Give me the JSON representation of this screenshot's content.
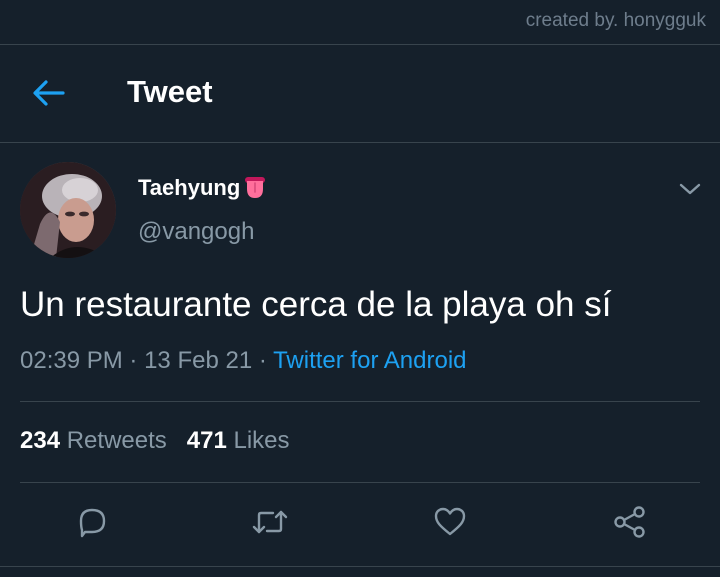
{
  "watermark": "created by. honygguk",
  "header": {
    "title": "Tweet",
    "back_icon": "arrow-left-icon"
  },
  "tweet": {
    "display_name": "Taehyung",
    "name_emoji_icon": "tongue-emoji-icon",
    "handle": "@vangogh",
    "text": "Un restaurante cerca de la playa oh sí",
    "time": "02:39 PM",
    "separator": "·",
    "date": "13 Feb 21",
    "source": "Twitter for Android"
  },
  "stats": {
    "retweets_count": "234",
    "retweets_label": "Retweets",
    "likes_count": "471",
    "likes_label": "Likes"
  },
  "actions": [
    "reply-icon",
    "retweet-icon",
    "like-icon",
    "share-icon"
  ],
  "colors": {
    "background": "#15202b",
    "divider": "#38444d",
    "accent": "#1da1f2",
    "secondary_text": "#8899a6",
    "primary_text": "#ffffff"
  }
}
